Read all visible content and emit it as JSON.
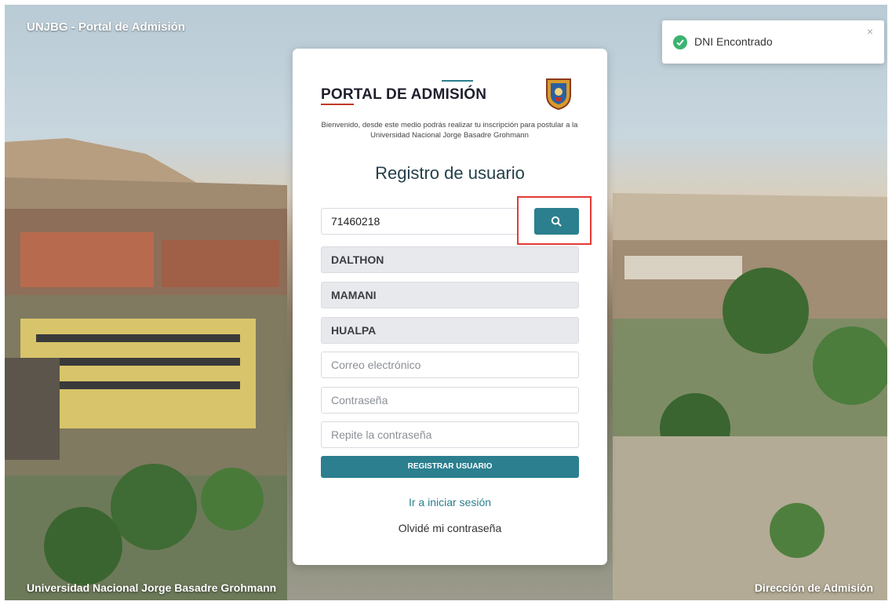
{
  "header": {
    "title": "UNJBG - Portal de Admisión"
  },
  "footer": {
    "left": "Universidad Nacional Jorge Basadre Grohmann",
    "right": "Dirección de Admisión"
  },
  "toast": {
    "message": "DNI Encontrado",
    "close": "×",
    "icon": "check-circle-icon"
  },
  "card": {
    "title": "PORTAL DE ADMISIÓN",
    "welcome": "Bienvenido, desde este medio podrás realizar tu inscripción para postular a la Universidad Nacional Jorge Basadre Grohmann",
    "form_title": "Registro de usuario",
    "dni": {
      "value": "71460218"
    },
    "search_icon": "search-icon",
    "names": "DALTHON",
    "paternal_surname": "MAMANI",
    "maternal_surname": "HUALPA",
    "email_placeholder": "Correo electrónico",
    "password_placeholder": "Contraseña",
    "repeat_password_placeholder": "Repite la contraseña",
    "submit_label": "REGISTRAR USUARIO",
    "login_link": "Ir a iniciar sesión",
    "forgot_link": "Olvidé mi contraseña"
  },
  "colors": {
    "accent": "#2b7f8e",
    "highlight": "#e53935",
    "success": "#3cb371",
    "title_rule": "#c0392b"
  }
}
